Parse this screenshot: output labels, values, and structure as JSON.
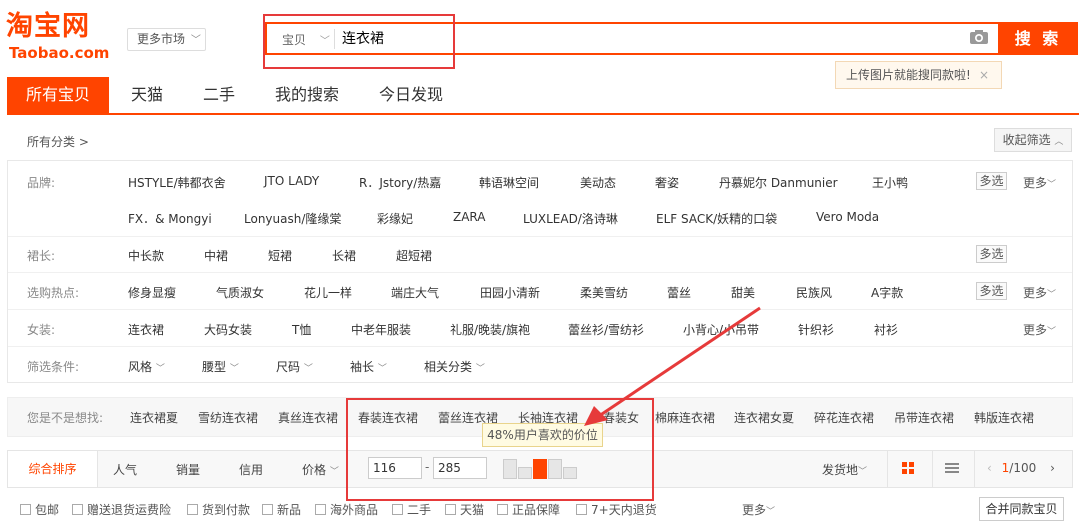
{
  "header": {
    "logo_cn": "淘宝网",
    "logo_en": "Taobao.com",
    "more_market": "更多市场",
    "search_type": "宝贝",
    "search_value": "连衣裙",
    "search_button": "搜 索",
    "image_tip": "上传图片就能搜同款啦!",
    "tip_close": "×",
    "camera_icon": "camera-icon"
  },
  "tabs": [
    "所有宝贝",
    "天猫",
    "二手",
    "我的搜索",
    "今日发现"
  ],
  "all_categories": "所有分类 >",
  "collapse_filter": "收起筛选",
  "filters": {
    "brand": {
      "label": "品牌:",
      "row1": [
        "HSTYLE/韩都衣舍",
        "JTO LADY",
        "R．Jstory/热嘉",
        "韩语琳空间",
        "美动态",
        "奢姿",
        "丹慕妮尔 Danmunier",
        "王小鸭"
      ],
      "row2": [
        "FX．& Mongyi",
        "Lonyuash/隆缘棠",
        "彩缘妃",
        "ZARA",
        "LUXLEAD/洛诗琳",
        "ELF SACK/妖精的口袋",
        "Vero Moda"
      ],
      "multi": "多选",
      "more": "更多"
    },
    "length": {
      "label": "裙长:",
      "items": [
        "中长款",
        "中裙",
        "短裙",
        "长裙",
        "超短裙"
      ],
      "multi": "多选"
    },
    "hot": {
      "label": "选购热点:",
      "items": [
        "修身显瘦",
        "气质淑女",
        "花儿一样",
        "端庄大气",
        "田园小清新",
        "柔美雪纺",
        "蕾丝",
        "甜美",
        "民族风",
        "A字款"
      ],
      "multi": "多选",
      "more": "更多"
    },
    "women": {
      "label": "女装:",
      "items": [
        "连衣裙",
        "大码女装",
        "T恤",
        "中老年服装",
        "礼服/晚装/旗袍",
        "蕾丝衫/雪纺衫",
        "小背心/小吊带",
        "针织衫",
        "衬衫"
      ],
      "more": "更多"
    },
    "conditions": {
      "label": "筛选条件:",
      "items": [
        "风格",
        "腰型",
        "尺码",
        "袖长",
        "相关分类"
      ]
    }
  },
  "guess": {
    "label": "您是不是想找:",
    "items": [
      "连衣裙夏",
      "雪纺连衣裙",
      "真丝连衣裙",
      "春装连衣裙",
      "蕾丝连衣裙",
      "长袖连衣裙",
      "春装女",
      "棉麻连衣裙",
      "连衣裙女夏",
      "碎花连衣裙",
      "吊带连衣裙",
      "韩版连衣裙"
    ]
  },
  "sort": {
    "items": [
      "综合排序",
      "人气",
      "销量",
      "信用",
      "价格"
    ],
    "price_min": "116",
    "price_dash": "-",
    "price_max": "285",
    "price_tip": "48%用户喜欢的价位",
    "ship_from": "发货地",
    "page_current": "1",
    "page_total": "/100"
  },
  "checks": [
    "包邮",
    "赠送退货运费险",
    "货到付款",
    "新品",
    "海外商品",
    "二手",
    "天猫",
    "正品保障",
    "7+天内退货"
  ],
  "more_checks": "更多",
  "merge_button": "合并同款宝贝",
  "colors": {
    "accent": "#ff4400",
    "annotation": "#e63a3a"
  }
}
